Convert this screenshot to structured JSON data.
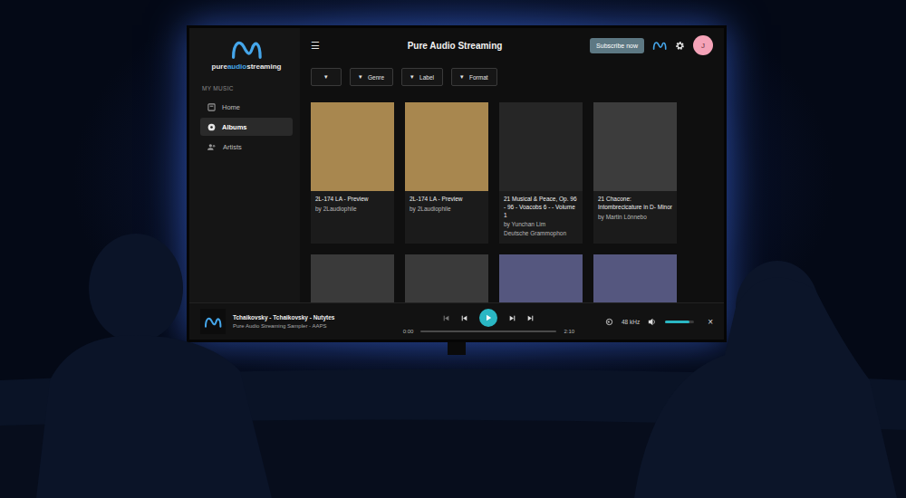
{
  "app": {
    "logo": [
      "pure",
      "audio",
      "streaming"
    ],
    "menu_icon": "☰",
    "title": "Pure Audio Streaming",
    "subscribe": "Subscribe now",
    "avatar": "J"
  },
  "sidebar": {
    "section": "MY MUSIC",
    "items": [
      {
        "label": "Home",
        "selected": false
      },
      {
        "label": "Albums",
        "selected": true
      },
      {
        "label": "Artists",
        "selected": false
      }
    ]
  },
  "filters": [
    {
      "label": "",
      "arrow": "▾"
    },
    {
      "label": "Genre",
      "arrow": "▾"
    },
    {
      "label": "Label",
      "arrow": "▾"
    },
    {
      "label": "Format",
      "arrow": "▾"
    }
  ],
  "albums": [
    {
      "title": "2L-174 LA - Preview",
      "artist": "by 2Laudiophile",
      "label": "",
      "color": "#a8874f"
    },
    {
      "title": "2L-174 LA - Preview",
      "artist": "by 2Laudiophile",
      "label": "",
      "color": "#a8874f"
    },
    {
      "title": "21 Musical & Peace, Op. 96 - 96 - Voacobs  6 - - Volume 1",
      "artist": "by Yunchan Lim",
      "label": "Deutsche Grammophon",
      "color": "#262626"
    },
    {
      "title": "21 Chacone: Intombrecicature in D- Minor",
      "artist": "by Martin Lönnebo",
      "label": "",
      "color": "#3c3c3c"
    },
    {
      "title": "",
      "artist": "",
      "label": "",
      "color": "#3a3a3a"
    },
    {
      "title": "",
      "artist": "",
      "label": "",
      "color": "#3a3a3a"
    },
    {
      "title": "",
      "artist": "",
      "label": "",
      "color": "#55577f"
    },
    {
      "title": "",
      "artist": "",
      "label": "",
      "color": "#55577f"
    }
  ],
  "player": {
    "title": "Tchaikovsky - Tchaikovsky - Nutytes",
    "subtitle": "Pure Audio Streaming Sampler - AAPS",
    "playing": false,
    "elapsed": "0:00",
    "duration": "2:10",
    "level": 0,
    "sample_rate": "48 kHz",
    "volume": 0.85,
    "close": "×"
  }
}
